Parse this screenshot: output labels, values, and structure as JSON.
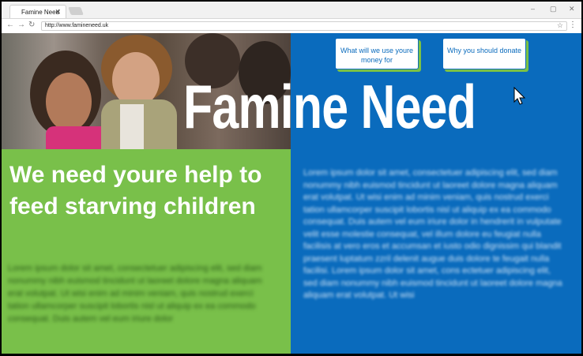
{
  "browser": {
    "tab_title": "Famine Need",
    "tab_close": "✕",
    "url": "http://www.famineneed.uk",
    "window_controls": {
      "minimize": "–",
      "maximize": "▢",
      "close": "✕"
    },
    "nav_icons": {
      "back": "←",
      "forward": "→",
      "reload": "↻"
    },
    "star_icon": "☆",
    "menu_icon": "⋮"
  },
  "site": {
    "brand": "Famine Need",
    "nav_buttons": [
      {
        "label": "What will we use youre money for"
      },
      {
        "label": "Why you should donate"
      }
    ],
    "headline": "We need youre help to feed starving children",
    "body_left": "Lorem ipsum dolor sit amet, consectetuer adipiscing elit, sed diam nonummy nibh euismod tincidunt ut laoreet dolore magna aliquam erat volutpat. Ut wisi enim ad minim veniam, quis nostrud exerci tation ullamcorper suscipit lobortis nisl ut aliquip ex ea commodo consequat. Duis autem vel eum iriure dolor",
    "body_right": "Lorem ipsum dolor sit amet, consectetuer adipiscing elit, sed diam nonummy nibh euismod tincidunt ut laoreet dolore magna aliquam erat volutpat. Ut wisi enim ad minim veniam, quis nostrud exerci tation ullamcorper suscipit lobortis nisl ut aliquip ex ea commodo consequat. Duis autem vel eum iriure dolor in hendrerit in vulputate velit esse molestie consequat, vel illum dolore eu feugiat nulla facilisis at vero eros et accumsan et iusto odio dignissim qui blandit praesent luptatum zzril delenit augue duis dolore te feugait nulla facilisi. Lorem ipsum dolor sit amet, cons ectetuer adipiscing elit, sed diam nonummy nibh euismod tincidunt ut laoreet dolore magna aliquam erat volutpat. Ut wisi",
    "colors": {
      "blue": "#0a6bbd",
      "green": "#79c04a",
      "white": "#ffffff"
    }
  }
}
